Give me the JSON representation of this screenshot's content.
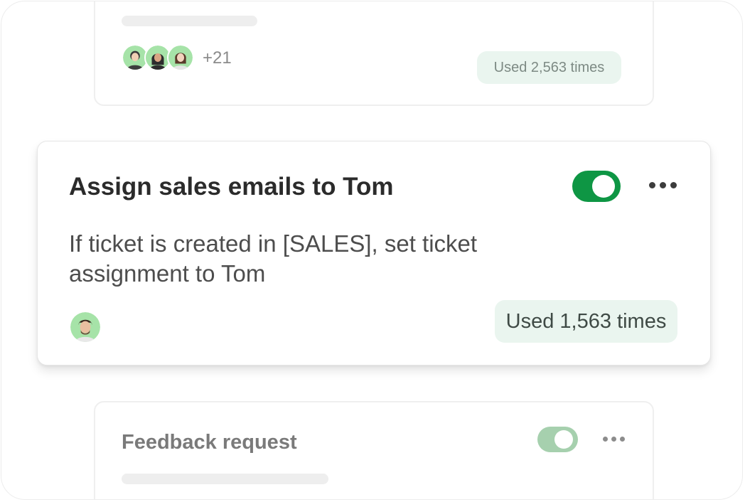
{
  "top_card": {
    "extra_count": "+21",
    "usage": "Used 2,563 times"
  },
  "main_card": {
    "title": "Assign sales emails to Tom",
    "description": "If ticket is created in [SALES], set ticket assignment to Tom",
    "usage": "Used 1,563 times",
    "toggle_on": true
  },
  "bottom_card": {
    "title": "Feedback request",
    "toggle_on": true
  },
  "icons": {
    "more": "more-horizontal-icon",
    "avatar": "user-avatar"
  },
  "colors": {
    "toggle_active": "#0e9644",
    "toggle_faded": "#a6d0ae",
    "badge_bg": "#eaf5ef",
    "avatar_bg": "#a6e3a8"
  }
}
